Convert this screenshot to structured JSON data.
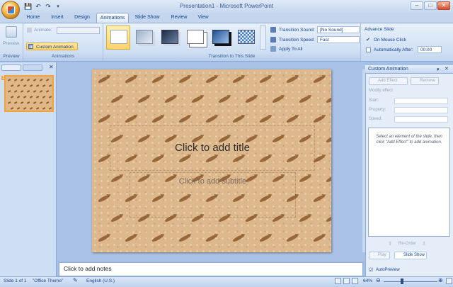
{
  "window": {
    "title": "Presentation1 - Microsoft PowerPoint",
    "min": "–",
    "max": "□",
    "close": "✕"
  },
  "qat": {
    "save": "💾",
    "undo": "↶",
    "redo": "↷",
    "more": "▾"
  },
  "tabs": [
    {
      "label": "Home"
    },
    {
      "label": "Insert"
    },
    {
      "label": "Design"
    },
    {
      "label": "Animations",
      "active": true
    },
    {
      "label": "Slide Show"
    },
    {
      "label": "Review"
    },
    {
      "label": "View"
    }
  ],
  "ribbon": {
    "preview": {
      "button_label": "Preview",
      "group_label": "Preview"
    },
    "animations": {
      "animate_label": "Animate:",
      "custom_animation_label": "Custom Animation",
      "group_label": "Animations"
    },
    "transition": {
      "group_label": "Transition to This Slide",
      "sound_label": "Transition Sound:",
      "sound_value": "[No Sound]",
      "speed_label": "Transition Speed:",
      "speed_value": "Fast",
      "apply_all_label": "Apply To All"
    },
    "advance": {
      "title": "Advance Slide",
      "on_mouse_click_label": "On Mouse Click",
      "on_mouse_click_checked": true,
      "auto_after_label": "Automatically After:",
      "auto_after_value": "00:00"
    }
  },
  "slides_pane": {
    "slide_number": "1"
  },
  "slide": {
    "title_placeholder": "Click to add title",
    "subtitle_placeholder": "Click to add subtitle"
  },
  "notes": {
    "placeholder": "Click to add notes"
  },
  "custom_animation_pane": {
    "title": "Custom Animation",
    "add_effect_label": "Add Effect",
    "remove_label": "Remove",
    "modify_label": "Modify effect",
    "start_label": "Start:",
    "property_label": "Property:",
    "speed_label": "Speed:",
    "hint": "Select an element of the slide, then click \"Add Effect\" to add animation.",
    "reorder_label": "Re-Order",
    "play_label": "Play",
    "slide_show_label": "Slide Show",
    "autopreview_label": "AutoPreview",
    "autopreview_checked": true
  },
  "status": {
    "slide_info": "Slide 1 of 1",
    "theme": "\"Office Theme\"",
    "language": "English (U.S.)",
    "zoom": "64%"
  }
}
